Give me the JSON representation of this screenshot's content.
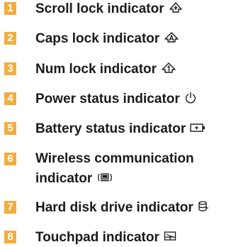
{
  "items": [
    {
      "number": "1",
      "label": "Scroll lock indicator",
      "icon": "scroll-lock-icon"
    },
    {
      "number": "2",
      "label": "Caps lock indicator",
      "icon": "caps-lock-icon"
    },
    {
      "number": "3",
      "label": "Num lock indicator",
      "icon": "num-lock-icon"
    },
    {
      "number": "4",
      "label": "Power status indicator",
      "icon": "power-icon"
    },
    {
      "number": "5",
      "label": "Battery status indicator",
      "icon": "battery-icon"
    },
    {
      "number": "6",
      "label_line1": "Wireless communication",
      "label_line2": "indicator",
      "icon": "wireless-icon"
    },
    {
      "number": "7",
      "label": "Hard disk drive indicator",
      "icon": "hard-disk-icon"
    },
    {
      "number": "8",
      "label": "Touchpad indicator",
      "icon": "touchpad-icon"
    }
  ],
  "colors": {
    "badge": "#f3ad3d",
    "text": "#1a1a1a"
  }
}
